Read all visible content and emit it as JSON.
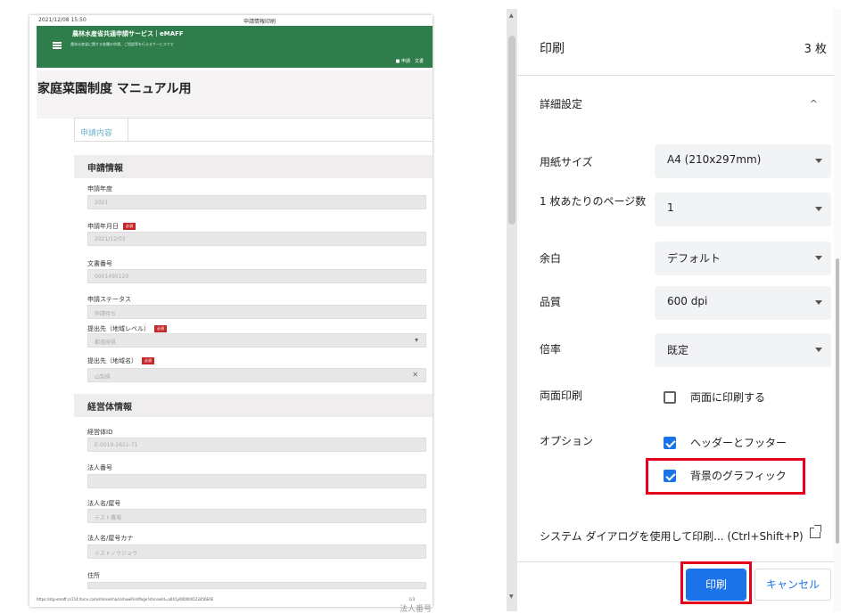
{
  "preview": {
    "header_date": "2021/12/08 15:50",
    "header_page_title": "申請情報印刷",
    "banner_title": "農林水産省共通申請サービス｜eMAFF",
    "banner_sub": "農林水産省に関する各種の申請、ご相談等を行えるサービスです",
    "banner_btns": "■ 申請　文書",
    "doc_title": "家庭菜園制度 マニュアル用",
    "tab": "申請内容",
    "sec_apply": "申請情報",
    "f1_label": "申請年度",
    "f1_value": "2021",
    "f2_label": "申請年月日",
    "f2_value": "2021/12/03",
    "required": "必須",
    "f3_label": "文書番号",
    "f3_value": "0001495120",
    "f4_label": "申請ステータス",
    "f4_value": "申請待ち",
    "f5_label": "提出先（地域レベル）",
    "f5_value": "都道府県",
    "f5_suffix": "▾",
    "f6_label": "提出先（地域名）",
    "f6_value": "山梨県",
    "f6_suffix": "✕",
    "sec_mgmt": "経営体情報",
    "f7_label": "経営体ID",
    "f7_value": "E-0019-1611-71",
    "f8_label": "法人番号",
    "f8_value": "",
    "f9_label": "法人名/屋号",
    "f9_value": "テスト農場",
    "f10_label": "法人名/屋号カナ",
    "f10_value": "テストノウジョウ",
    "f11_label": "住所",
    "footer_url": "https://stg-emaff.cs114.force.com/shinseisha/s/showPrintPage?shinseiId=a0X1y000000123456EAE",
    "page_num": "1/3",
    "below_text": "法人番号"
  },
  "panel": {
    "title": "印刷",
    "count": "3 枚",
    "advanced": "詳細設定",
    "paper_label": "用紙サイズ",
    "paper_value": "A4 (210x297mm)",
    "pps_label": "1 枚あたりのページ数",
    "pps_value": "1",
    "margin_label": "余白",
    "margin_value": "デフォルト",
    "quality_label": "品質",
    "quality_value": "600 dpi",
    "scale_label": "倍率",
    "scale_value": "既定",
    "duplex_label": "両面印刷",
    "duplex_option": "両面に印刷する",
    "options_label": "オプション",
    "opt_headers": "ヘッダーとフッター",
    "opt_bg": "背景のグラフィック",
    "system_dialog": "システム ダイアログを使用して印刷... (Ctrl+Shift+P)",
    "print_btn": "印刷",
    "cancel_btn": "キャンセル"
  },
  "colors": {
    "accent": "#1a73e8",
    "highlight": "#e5001c",
    "banner": "#2e7d4a"
  }
}
